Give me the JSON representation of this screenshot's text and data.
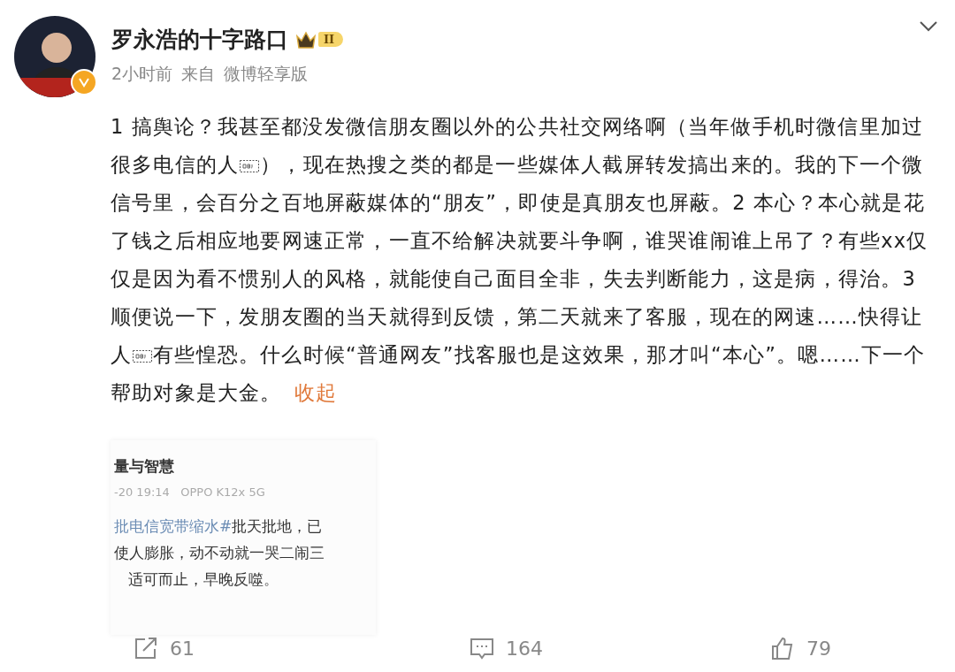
{
  "author": {
    "name": "罗永浩的十字路口",
    "level_badge": "II",
    "verified": true
  },
  "meta": {
    "time": "2小时前",
    "source_prefix": "来自",
    "source": "微博轻享版"
  },
  "post": {
    "segments": [
      {
        "kind": "text",
        "text": "1 搞舆论？我甚至都没发微信朋友圈以外的公共社交网络啊（当年做手机时微信里加过很多电信的人"
      },
      {
        "kind": "object"
      },
      {
        "kind": "text",
        "text": "），现在热搜之类的都是一些媒体人截屏转发搞出来的。我的下一个微信号里，会百分之百地屏蔽媒体的“朋友”，即使是真朋友也屏蔽。2 本心？本心就是花了钱之后相应地要网速正常，一直不给解决就要斗争啊，谁哭谁闹谁上吊了？有些xx仅仅是因为看不惯别人的风格，就能使自己面目全非，失去判断能力，这是病，得治。3 顺便说一下，发朋友圈的当天就得到反馈，第二天就来了客服，现在的网速……快得让人"
      },
      {
        "kind": "object"
      },
      {
        "kind": "text",
        "text": "有些惶恐。什么时候“普通网友”找客服也是这效果，那才叫“本心”。嗯……下一个帮助对象是大金。"
      }
    ],
    "collapse_link": "收起"
  },
  "embedded_screenshot": {
    "title": "量与智慧",
    "meta": "-20 19:14   OPPO K12x 5G",
    "lines": [
      {
        "hashtag": "批电信宽带缩水#",
        "text": "批天批地，已"
      },
      {
        "text": "使人膨胀，动不动就一哭二闹三"
      },
      {
        "text": "适可而止，早晚反噬。"
      }
    ]
  },
  "actions": [
    {
      "kind": "repost",
      "count": "61"
    },
    {
      "kind": "comment",
      "count": "164"
    },
    {
      "kind": "like",
      "count": "79"
    }
  ]
}
